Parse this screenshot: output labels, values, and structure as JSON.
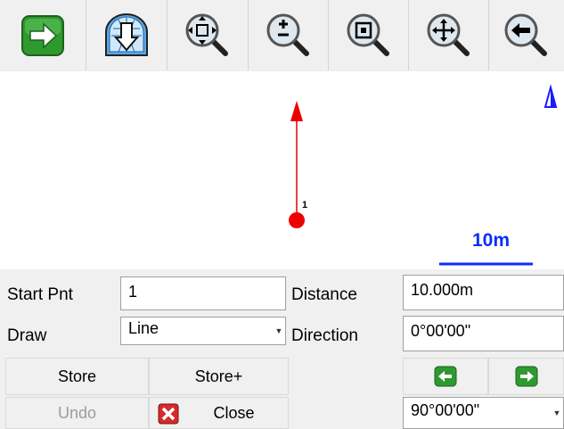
{
  "toolbar": {
    "buttons": [
      {
        "name": "next-arrow-button",
        "icon": "green-right-arrow-icon"
      },
      {
        "name": "download-button",
        "icon": "globe-download-icon"
      },
      {
        "name": "zoom-extent-button",
        "icon": "zoom-extent-icon"
      },
      {
        "name": "zoom-in-out-button",
        "icon": "zoom-plus-minus-icon"
      },
      {
        "name": "zoom-window-button",
        "icon": "zoom-window-icon"
      },
      {
        "name": "pan-button",
        "icon": "pan-icon"
      },
      {
        "name": "zoom-previous-button",
        "icon": "zoom-back-icon"
      }
    ]
  },
  "map": {
    "point_label": "1",
    "scale_text": "10m",
    "north_icon": "north-arrow-icon",
    "colors": {
      "line": "#e00000",
      "scale": "#0a2cff",
      "north": "#1a1aff"
    }
  },
  "form": {
    "start_pnt_label": "Start Pnt",
    "start_pnt_value": "1",
    "distance_label": "Distance",
    "distance_value": "10.000m",
    "draw_label": "Draw",
    "draw_value": "Line",
    "direction_label": "Direction",
    "direction_value": "0°00'00\"",
    "store_label": "Store",
    "store_plus_label": "Store+",
    "undo_label": "Undo",
    "close_label": "Close",
    "angle_value": "90°00'00\""
  }
}
